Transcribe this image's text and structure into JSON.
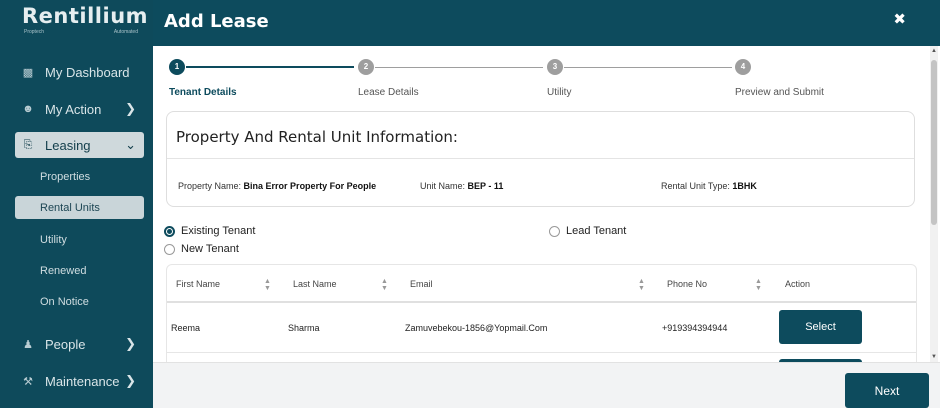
{
  "logo": {
    "text": "Rentillium",
    "tag_left": "Proptech",
    "tag_right": "Automated"
  },
  "sidebar": {
    "items": [
      {
        "label": "My Dashboard",
        "icon": "grid-icon"
      },
      {
        "label": "My Action",
        "icon": "user-icon"
      },
      {
        "label": "Leasing",
        "icon": "lock-icon"
      },
      {
        "label": "People",
        "icon": "people-icon"
      },
      {
        "label": "Maintenance",
        "icon": "tools-icon"
      }
    ],
    "leasing_sub": [
      "Properties",
      "Rental Units",
      "Utility",
      "Renewed",
      "On Notice"
    ]
  },
  "modal": {
    "title": "Add Lease",
    "close": "✖"
  },
  "steps": [
    {
      "num": "1",
      "label": "Tenant Details"
    },
    {
      "num": "2",
      "label": "Lease Details"
    },
    {
      "num": "3",
      "label": "Utility"
    },
    {
      "num": "4",
      "label": "Preview and Submit"
    }
  ],
  "info": {
    "title": "Property And Rental Unit Information:",
    "property_label": "Property Name:",
    "property_value": "Bina Error Property For People",
    "unit_label": "Unit Name:",
    "unit_value": "BEP - 11",
    "type_label": "Rental Unit Type:",
    "type_value": "1BHK"
  },
  "tenant_options": {
    "existing": "Existing Tenant",
    "lead": "Lead Tenant",
    "new": "New Tenant",
    "selected": "existing"
  },
  "table": {
    "headers": [
      "First Name",
      "Last Name",
      "Email",
      "Phone No",
      "Action"
    ],
    "rows": [
      {
        "first": "Reema",
        "last": "Sharma",
        "email": "Zamuvebekou-1856@Yopmail.Com",
        "phone": "+919394394944",
        "action": "Select"
      }
    ]
  },
  "footer": {
    "next": "Next"
  },
  "colors": {
    "primary": "#0d4b5d",
    "sidebar": "#0e4a5b"
  }
}
